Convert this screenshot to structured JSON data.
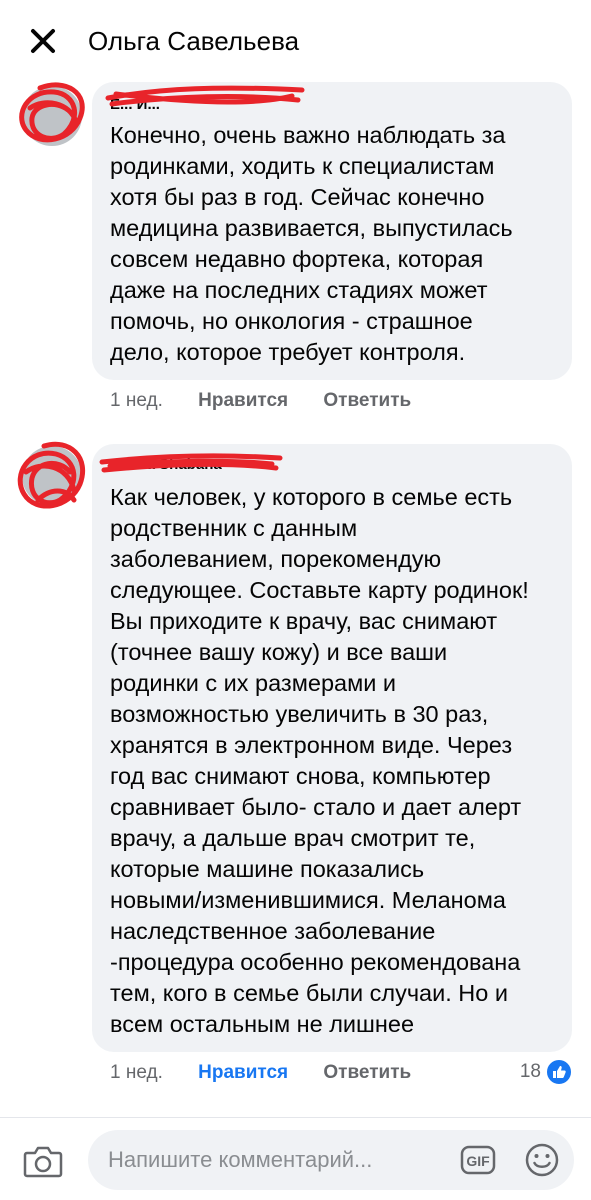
{
  "header": {
    "title": "Ольга Савельева",
    "close_icon": "close-icon"
  },
  "comments": [
    {
      "author": "Е... И...",
      "text_lines": [
        " Конечно, очень важно наблюдать за",
        "родинками, ходить к специалистам",
        "хотя бы раз в год. Сейчас конечно",
        "медицина развивается, выпустилась",
        "совсем недавно фортека, которая",
        "даже на последних стадиях может",
        "помочь, но онкология - страшное",
        "дело, которое требует контроля."
      ],
      "time": "1 нед.",
      "like_label": "Нравится",
      "reply_label": "Ответить",
      "liked": false
    },
    {
      "author": "Polina Shabana",
      "text_lines": [
        "Как человек, у которого в семье есть",
        "родственник с данным",
        "заболеванием, порекомендую",
        "следующее. Составьте карту родинок!",
        "Вы приходите к врачу, вас снимают",
        "(точнее вашу кожу) и все ваши",
        "родинки с их размерами и",
        "возможностью увеличить в 30 раз,",
        "хранятся в электронном виде. Через",
        "год вас снимают снова, компьютер",
        "сравнивает было- стало и дает алерт",
        "врачу, а дальше врач смотрит те,",
        "которые машине показались",
        "новыми/изменившимися. Меланома",
        "наследственное заболевание",
        "-процедура особенно рекомендована",
        "тем, кого в семье были случаи. Но и",
        "всем остальным не лишнее"
      ],
      "time": "1 нед.",
      "like_label": "Нравится",
      "reply_label": "Ответить",
      "liked": true,
      "reaction_count": "18",
      "reaction_icon": "thumbs-up-icon"
    }
  ],
  "composer": {
    "placeholder": "Напишите комментарий...",
    "camera_icon": "camera-icon",
    "gif_label": "GIF",
    "emoji_icon": "smiley-icon"
  },
  "colors": {
    "accent": "#1877f2",
    "bubble": "#f0f2f5",
    "muted": "#65676b",
    "scribble": "#e8242a"
  }
}
